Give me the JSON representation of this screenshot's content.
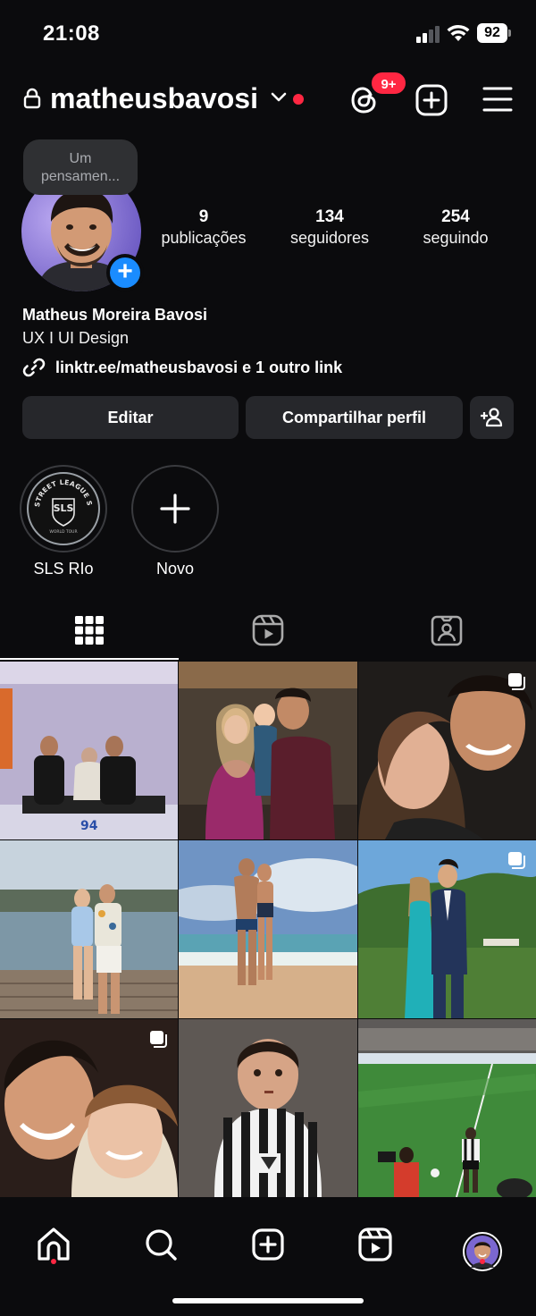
{
  "status_bar": {
    "time": "21:08",
    "battery": "92"
  },
  "header": {
    "username": "matheusbavosi",
    "notification_badge": "9+",
    "icons": [
      "lock-icon",
      "chevron-down-icon",
      "threads-icon",
      "add-post-icon",
      "menu-icon"
    ]
  },
  "note": {
    "line1": "Um",
    "line2": "pensamen..."
  },
  "stats": [
    {
      "value": "9",
      "label": "publicações"
    },
    {
      "value": "134",
      "label": "seguidores"
    },
    {
      "value": "254",
      "label": "seguindo"
    }
  ],
  "profile": {
    "full_name": "Matheus Moreira Bavosi",
    "bio": "UX I UI Design",
    "link": "linktr.ee/matheusbavosi e 1 outro link"
  },
  "buttons": {
    "edit": "Editar",
    "share": "Compartilhar perfil"
  },
  "highlights": [
    {
      "label": "SLS RIo",
      "logo_text": "SLS",
      "ring_text": "STREET LEAGUE SKATEBOARDING",
      "sub_text": "WORLD TOUR"
    },
    {
      "label": "Novo"
    }
  ],
  "tabs": [
    "grid-icon",
    "reels-icon",
    "tagged-icon"
  ],
  "posts": [
    {
      "subject": "family-birthday",
      "overlay_text": "94",
      "multi": false
    },
    {
      "subject": "couple-with-baby",
      "multi": false
    },
    {
      "subject": "couple-selfie",
      "multi": true
    },
    {
      "subject": "couple-on-pier",
      "multi": false
    },
    {
      "subject": "couple-at-beach",
      "multi": false
    },
    {
      "subject": "couple-formal-event",
      "multi": true
    },
    {
      "subject": "couple-close-selfie",
      "multi": true
    },
    {
      "subject": "child-in-jersey",
      "multi": false
    },
    {
      "subject": "soccer-stadium",
      "multi": false
    }
  ],
  "bottom_nav": [
    "home-icon",
    "search-icon",
    "create-icon",
    "reels-icon",
    "profile-avatar"
  ],
  "colors": {
    "background": "#0b0b0d",
    "accent_red": "#ff2742",
    "accent_blue": "#1a8cff",
    "button_bg": "#26272b"
  }
}
